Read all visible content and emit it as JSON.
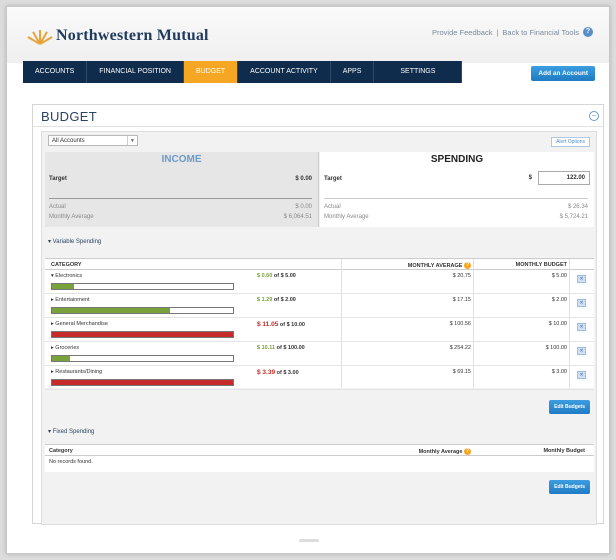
{
  "brand": {
    "name": "Northwestern Mutual"
  },
  "top_links": {
    "feedback": "Provide Feedback",
    "separator": "|",
    "back": "Back to Financial Tools"
  },
  "nav": {
    "items": [
      "ACCOUNTS",
      "FINANCIAL POSITION",
      "BUDGET",
      "ACCOUNT ACTIVITY",
      "APPS",
      "SETTINGS"
    ],
    "active": "BUDGET"
  },
  "add_account": "Add an Account",
  "budget": {
    "title": "BUDGET",
    "account_select": "All Accounts",
    "alert_options": "Alert Options",
    "income": {
      "header": "INCOME",
      "target_label": "Target",
      "target_value": "$ 0.00",
      "actual_label": "Actual",
      "actual_value": "$ 0.00",
      "monthly_avg_label": "Monthly Average",
      "monthly_avg_value": "$ 6,064.51"
    },
    "spending": {
      "header": "SPENDING",
      "target_label": "Target",
      "dollar": "$",
      "target_input": "122.00",
      "actual_label": "Actual",
      "actual_value": "$ 26.34",
      "monthly_avg_label": "Monthly Average",
      "monthly_avg_value": "$ 5,724.21"
    },
    "variable": {
      "section": "▾ Variable Spending",
      "col_category": "CATEGORY",
      "col_avg": "MONTHLY AVERAGE",
      "col_budget": "MONTHLY BUDGET",
      "rows": [
        {
          "name": "▾ Electronics",
          "spent": "$ 0.60",
          "of": "of",
          "budget": "$ 5.00",
          "fill": 0.12,
          "color": "#7aa23a",
          "over": false,
          "avg": "$ 20.75",
          "mbudget": "$ 5.00"
        },
        {
          "name": "▸ Entertainment",
          "spent": "$ 1.29",
          "of": "of",
          "budget": "$ 2.00",
          "fill": 0.65,
          "color": "#7aa23a",
          "over": false,
          "avg": "$ 17.15",
          "mbudget": "$ 2.00"
        },
        {
          "name": "▸ General Merchandise",
          "spent": "$ 11.05",
          "of": "of",
          "budget": "$ 10.00",
          "fill": 1.0,
          "color": "#c62b2b",
          "over": true,
          "avg": "$ 100.56",
          "mbudget": "$ 10.00"
        },
        {
          "name": "▸ Groceries",
          "spent": "$ 10.11",
          "of": "of",
          "budget": "$ 100.00",
          "fill": 0.1,
          "color": "#7aa23a",
          "over": false,
          "avg": "$ 254.22",
          "mbudget": "$ 100.00"
        },
        {
          "name": "▸ Restaurants/Dining",
          "spent": "$ 3.39",
          "of": "of",
          "budget": "$ 3.00",
          "fill": 1.0,
          "color": "#c62b2b",
          "over": true,
          "avg": "$ 69.15",
          "mbudget": "$ 3.00"
        }
      ],
      "edit": "Edit Budgets"
    },
    "fixed": {
      "section": "▾ Fixed Spending",
      "col_category": "Category",
      "col_avg": "Monthly Average",
      "col_budget": "Monthly Budget",
      "empty": "No records found.",
      "edit": "Edit Budgets"
    }
  },
  "colors": {
    "accent": "#f5a623",
    "nav": "#0f2c4c",
    "button": "#1f7bc4",
    "over": "#c62b2b",
    "under": "#7aa23a"
  }
}
